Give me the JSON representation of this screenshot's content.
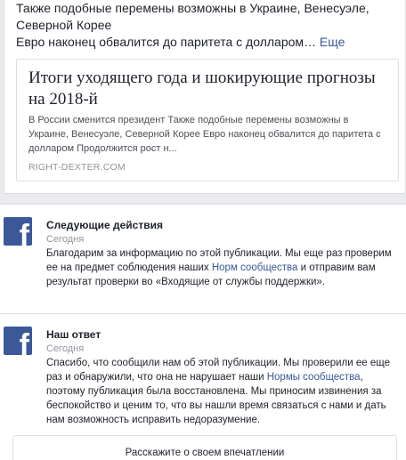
{
  "post": {
    "text_line1": "Также подобные перемены возможны в Украине, Венесуэле,",
    "text_line2": "Северной Корее",
    "text_line3": "Евро наконец обвалится до паритета с долларом…",
    "more_label": "Еще",
    "link": {
      "title": "Итоги уходящего года и шокирующие прогнозы на 2018-й",
      "description": "В России сменится президент Также подобные перемены возможны в Украине, Венесуэле, Северной Корее Евро наконец обвалится до паритета с долларом Продолжится рост н...",
      "domain": "RIGHT-DEXTER.COM"
    }
  },
  "messages": [
    {
      "title": "Следующие действия",
      "date": "Сегодня",
      "body_part1": "Благодарим за информацию по этой публикации. Мы еще раз проверим ее на предмет соблюдения наших ",
      "link_text": "Норм сообщества",
      "body_part2": " и отправим вам результат проверки во «Входящие от службы поддержки»."
    },
    {
      "title": "Наш ответ",
      "date": "Сегодня",
      "body_part1": "Спасибо, что сообщили нам об этой публикации. Мы проверили ее еще раз и обнаружили, что она не нарушает наши ",
      "link_text": "Нормы сообщества",
      "body_part2": ", поэтому публикация была восстановлена. Мы приносим извинения за беспокойство и ценим то, что вы нашли время связаться с нами и дать нам возможность исправить недоразумение."
    }
  ],
  "feedback_button_label": "Расскажите о своем впечатлении",
  "icons": {
    "facebook_logo": "facebook-logo-icon",
    "logo_glyph": "f"
  },
  "colors": {
    "facebook_blue": "#3b5998",
    "link_blue": "#385898",
    "background": "#e9ebee",
    "muted_text": "#90949c"
  }
}
